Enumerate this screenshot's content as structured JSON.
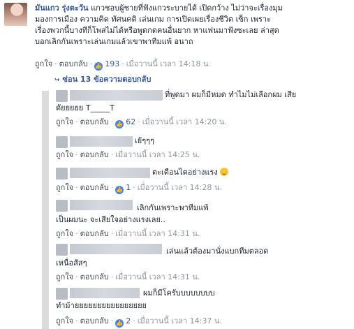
{
  "main_comment": {
    "author": "มันแกว รุ่งตะวัน",
    "lines": [
      "แกวชอบผู้ชายที่ฟังแกวระบายได้ เปิดกว้าง ไม่ว่าจะเรื่องมุม",
      "มองการเมือง ความคิด ทัศนคติ เล่นเกม การเปิดเผยเรื่องชีวิต เซ็ก เพราะ",
      "เรื่องพวกนี้บางทีก็โพสไม่ได้หรือพูดกดคนอื่นยาก หาแฟนมาฟังซะเลย ล่าสุด",
      "บอกเลิกกันเพราะเล่นเกมแล้วเขาพาทีมแพ้ อนาถ"
    ],
    "actions": {
      "like": "ถูกใจ",
      "reply": "ตอบกลับ",
      "like_count": "193",
      "time": "เมื่อวานนี้ เวลา 14:18 น."
    }
  },
  "replies_toggle": "ซ่อน 13 ข้อความตอบกลับ",
  "replies": [
    {
      "line1": "ที่พูดมา ผมก็มีหมด ทำไมไม่เลือกผม เสีย",
      "line2": "ดัยยยยย T_____T",
      "like": "ถูกใจ",
      "reply": "ตอบกลับ",
      "like_count": "62",
      "time": "เมื่อวานนี้ เวลา 14:20 น."
    },
    {
      "line1": "เย้ๆๆๆ",
      "like": "ถูกใจ",
      "reply": "ตอบกลับ",
      "time": "เมื่อวานนี้ เวลา 14:25 น."
    },
    {
      "line1": "ตะเตือนไตอย่างแรง",
      "like": "ถูกใจ",
      "reply": "ตอบกลับ",
      "like_count": "1",
      "time": "เมื่อวานนี้ เวลา 14:28 น."
    },
    {
      "line1": "เลิกกันเพราะพาทีมแพ้",
      "line2": "เป็นผมนะ จะเสียใจอย่างแรงเลย..",
      "like": "ถูกใจ",
      "reply": "ตอบกลับ",
      "time": "เมื่อวานนี้ เวลา 14:31 น."
    },
    {
      "line1": "เล่นแล้วต้องมานั่งแบกทีมตลอด",
      "line2": "เหนื่อสัสๆ",
      "like": "ถูกใจ",
      "reply": "ตอบกลับ",
      "time": "เมื่อวานนี้ เวลา 14:31 น."
    },
    {
      "line1": "ผมก็มีโครับบบบบบบบ",
      "line2": "ทำม้ายยยยยยยยยยยยยยยย",
      "like": "ถูกใจ",
      "reply": "ตอบกลับ",
      "like_count": "2",
      "time": "เมื่อวานนี้ เวลา 14:37 น."
    }
  ]
}
